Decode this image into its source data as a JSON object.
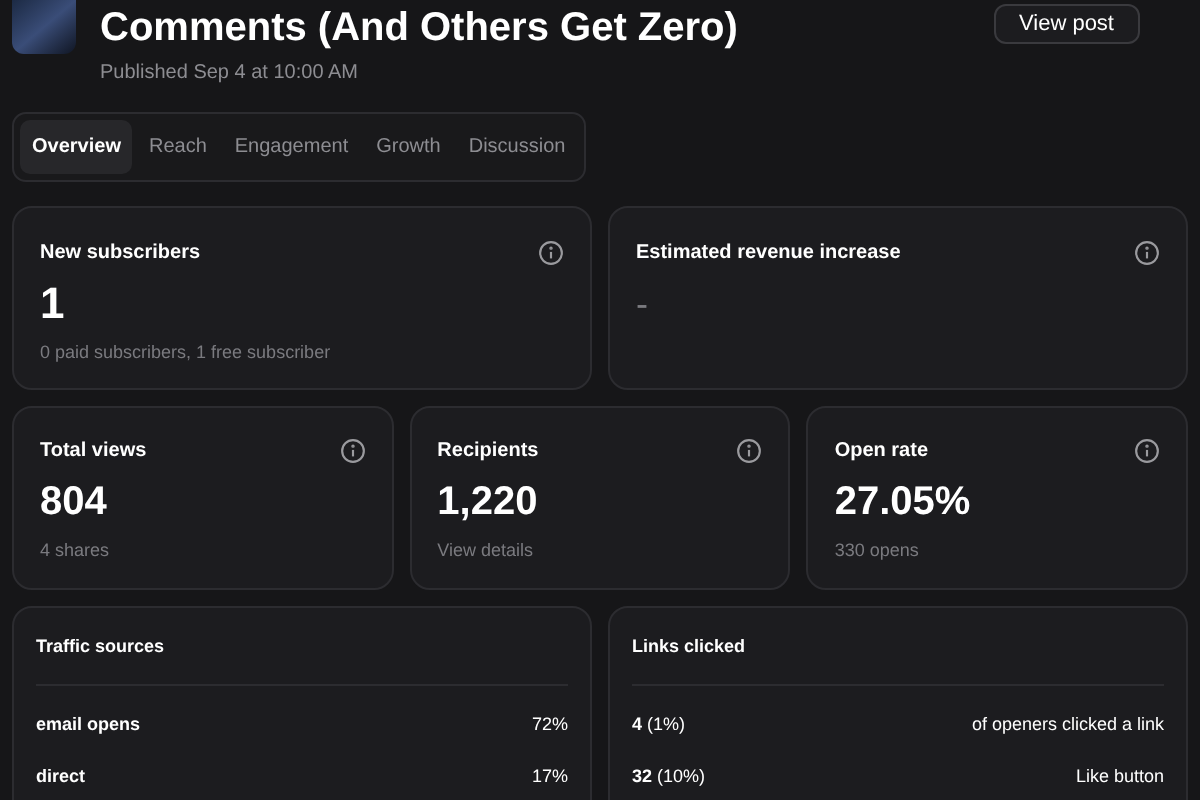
{
  "header": {
    "title": "Comments (And Others Get Zero)",
    "published": "Published Sep 4 at 10:00 AM",
    "view_button": "View post"
  },
  "tabs": [
    {
      "label": "Overview",
      "selected": true
    },
    {
      "label": "Reach",
      "selected": false
    },
    {
      "label": "Engagement",
      "selected": false
    },
    {
      "label": "Growth",
      "selected": false
    },
    {
      "label": "Discussion",
      "selected": false
    }
  ],
  "top_cards": [
    {
      "title": "New subscribers",
      "value": "1",
      "muted": false,
      "note": "0 paid subscribers, 1 free subscriber"
    },
    {
      "title": "Estimated revenue increase",
      "value": "-",
      "muted": true
    }
  ],
  "stat_cards": [
    {
      "title": "Total views",
      "value": "804",
      "note": "4 shares"
    },
    {
      "title": "Recipients",
      "value": "1,220",
      "note": "View details"
    },
    {
      "title": "Open rate",
      "value": "27.05%",
      "note": "330 opens"
    }
  ],
  "traffic_sources": {
    "title": "Traffic sources",
    "rows": [
      {
        "label": "email opens",
        "value": "72%"
      },
      {
        "label": "direct",
        "value": "17%"
      }
    ]
  },
  "links_clicked": {
    "title": "Links clicked",
    "rows": [
      {
        "count": "**4** (1%)",
        "label": "of openers clicked a link"
      },
      {
        "count": "**32** (10%)",
        "label": "Like button"
      }
    ]
  }
}
